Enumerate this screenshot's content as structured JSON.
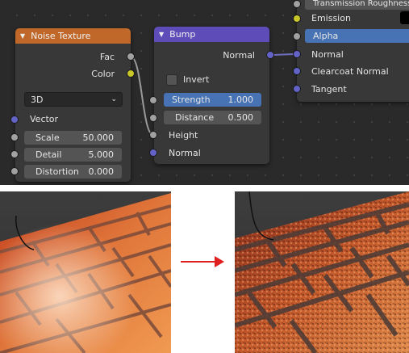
{
  "noise_node": {
    "title": "Noise Texture",
    "outputs": [
      "Fac",
      "Color"
    ],
    "dimensions": "3D",
    "vector_label": "Vector",
    "fields": [
      {
        "label": "Scale",
        "value": "50.000"
      },
      {
        "label": "Detail",
        "value": "5.000"
      },
      {
        "label": "Distortion",
        "value": "0.000"
      }
    ]
  },
  "bump_node": {
    "title": "Bump",
    "output": "Normal",
    "invert_label": "Invert",
    "fields": [
      {
        "label": "Strength",
        "value": "1.000"
      },
      {
        "label": "Distance",
        "value": "0.500"
      }
    ],
    "inputs": [
      "Height",
      "Normal"
    ]
  },
  "bsdf_node": {
    "rows": [
      "Transmission Roughness",
      "Emission",
      "Alpha",
      "Normal",
      "Clearcoat Normal",
      "Tangent"
    ],
    "active_row": "Alpha"
  },
  "colors": {
    "noise_header": "#c0682a",
    "bump_header": "#5e4cb8",
    "socket_grey": "#a1a1a1",
    "socket_yellow": "#c7c729",
    "socket_purple": "#6363c7",
    "active_field": "#4772b3",
    "arrow": "#e02020"
  },
  "comparison": {
    "before_icon": "render-before-bricks",
    "after_icon": "render-after-bricks-bumped",
    "arrow_icon": "right-arrow-icon"
  }
}
